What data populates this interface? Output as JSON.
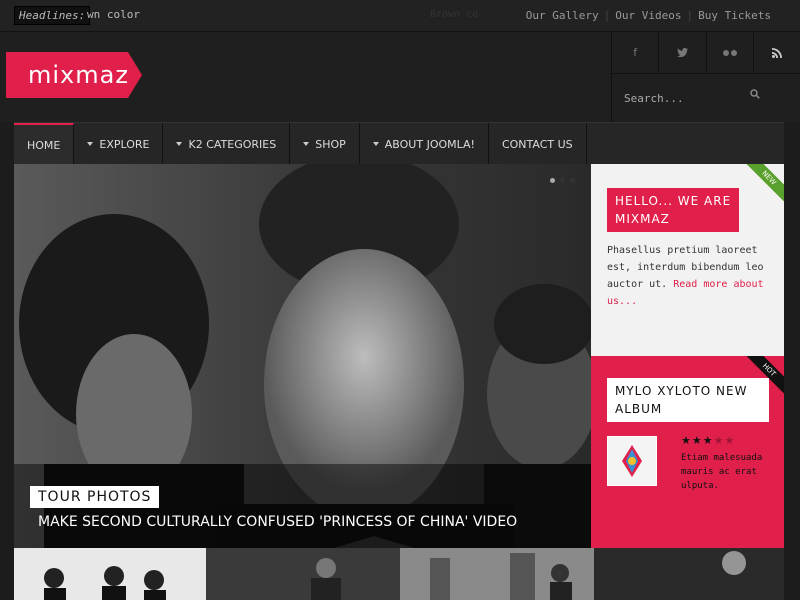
{
  "topbar": {
    "headlines_label": "Headlines:",
    "headline_text": "wn color",
    "headline_ghost": "Brown co",
    "links": [
      "Our Gallery",
      "Our Videos",
      "Buy Tickets"
    ]
  },
  "header": {
    "logo": "mixmaz",
    "social": [
      "f",
      "t",
      "flickr",
      "rss"
    ],
    "search_placeholder": "Search..."
  },
  "nav": {
    "items": [
      {
        "label": "HOME",
        "active": true,
        "dropdown": false
      },
      {
        "label": "EXPLORE",
        "dropdown": true
      },
      {
        "label": "K2 CATEGORIES",
        "dropdown": true
      },
      {
        "label": "SHOP",
        "dropdown": true
      },
      {
        "label": "ABOUT JOOMLA!",
        "dropdown": true
      },
      {
        "label": "CONTACT US",
        "dropdown": false
      }
    ]
  },
  "hero": {
    "tag": "TOUR PHOTOS",
    "title": "MAKE SECOND CULTURALLY CONFUSED 'PRINCESS OF CHINA' VIDEO",
    "slides": 3,
    "active_slide": 1
  },
  "sidebar": {
    "about": {
      "ribbon": "NEW",
      "heading_line1": "HELLO... WE ARE",
      "heading_line2": "MIXMAZ",
      "text": "Phasellus pretium laoreet est, interdum bibendum leo auctor ut.",
      "read_more": "Read more about us..."
    },
    "album": {
      "ribbon": "HOT",
      "heading_line1": "MYLO XYLOTO NEW",
      "heading_line2": "ALBUM",
      "rating": 3,
      "rating_max": 5,
      "text": "Etiam malesuada mauris ac erat ulputa."
    }
  },
  "colors": {
    "accent": "#e0204a",
    "background": "#1c1c1c",
    "nav": "#262626"
  }
}
